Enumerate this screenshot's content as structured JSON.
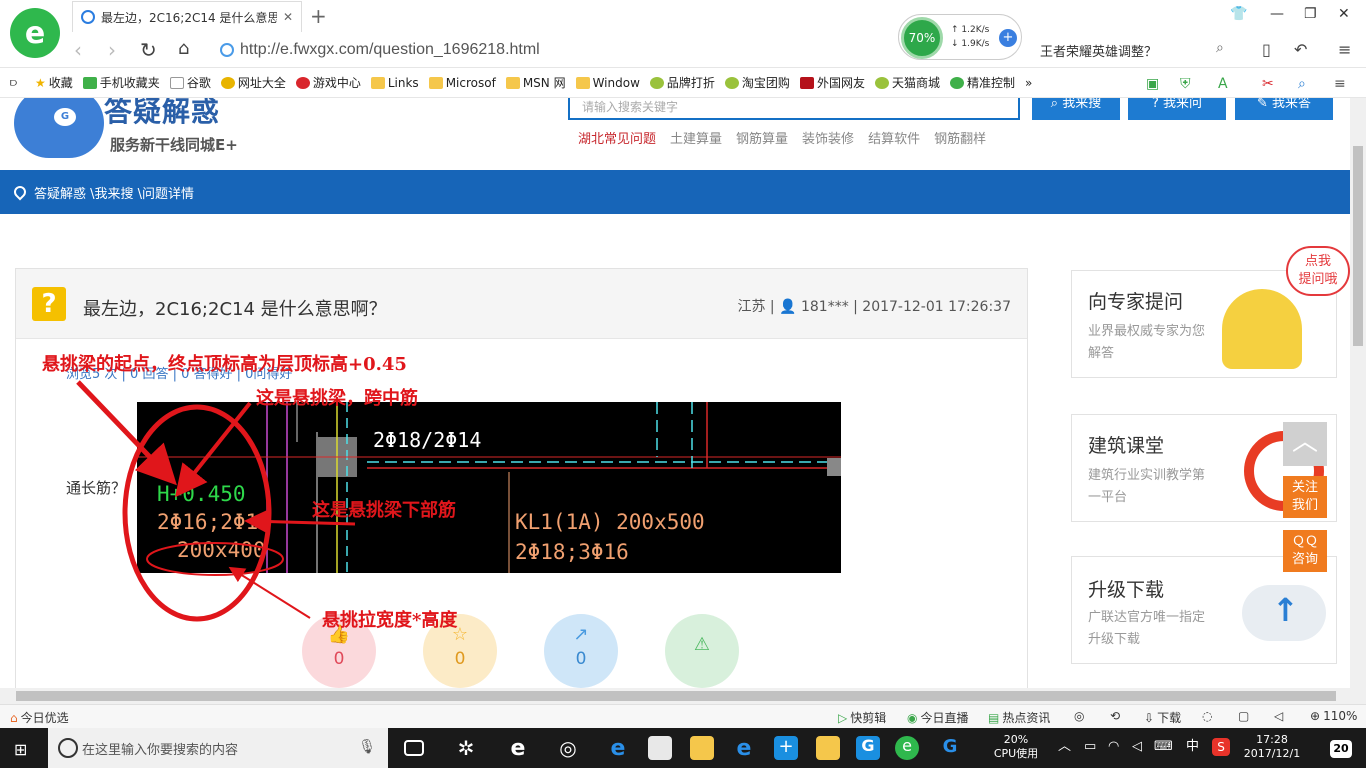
{
  "browser": {
    "tab_title": "最左边，2C16;2C14 是什么意思",
    "url": "http://e.fwxgx.com/question_1696218.html",
    "speed_percent": "70%",
    "speed_up": "1.2K/s",
    "speed_down": "1.9K/s",
    "search_text": "王者荣耀英雄调整？",
    "bookmarks": [
      "收藏",
      "手机收藏夹",
      "谷歌",
      "网址大全",
      "游戏中心",
      "Links",
      "Microsof",
      "MSN 网",
      "Window",
      "品牌打折",
      "淘宝团购",
      "外国网友",
      "天猫商城",
      "精准控制"
    ]
  },
  "site": {
    "name": "答疑解惑",
    "slogan": "服务新干线同城E+",
    "search_placeholder": "请输入搜索关键字",
    "btn_search": "我来搜",
    "btn_ask": "我来问",
    "btn_answer": "我来答",
    "categories": [
      "湖北常见问题",
      "土建算量",
      "钢筋算量",
      "装饰装修",
      "结算软件",
      "钢筋翻样"
    ],
    "breadcrumb": "答疑解惑 \\我来搜 \\问题详情"
  },
  "question": {
    "title": "最左边，2C16;2C14 是什么意思啊？",
    "meta": "江苏 | 👤 181*** | 2017-12-01 17:26:37",
    "stats": "浏览5 次 | 0 回答 | 0 答得好 | 0问得好",
    "body_label": "通长筋？",
    "cad": {
      "beam_label": "2Φ18/2Φ14",
      "elevation": "H+0.450",
      "rebar": "2Φ16;2Φ14",
      "size": "200x400",
      "kl_label": "KL1(1A) 200x500",
      "kl_rebar": "2Φ18;3Φ16"
    },
    "votes": [
      {
        "icon": "👍",
        "count": "0",
        "color": "#fbd9dc"
      },
      {
        "icon": "☆",
        "count": "0",
        "color": "#fcebc7"
      },
      {
        "icon": "↗",
        "count": "0",
        "color": "#cfe6f8"
      },
      {
        "icon": "⚠",
        "count": "",
        "color": "#d8f0dc"
      }
    ]
  },
  "annotations": {
    "a1": "悬挑梁的起点，终点顶标高为层顶标高+0.45",
    "a2": "这是悬挑梁，跨中筋",
    "a3": "这是悬挑梁下部筋",
    "a4": "悬挑拉宽度*高度"
  },
  "sidebar": {
    "bubble": "点我\n提问哦",
    "cards": [
      {
        "title": "向专家提问",
        "desc": "业界最权威专家为您解答"
      },
      {
        "title": "建筑课堂",
        "desc": "建筑行业实训教学第一平台"
      },
      {
        "title": "升级下载",
        "desc": "广联达官方唯一指定升级下载"
      }
    ],
    "follow": "关注\n我们",
    "qq": "ＱＱ\n咨询"
  },
  "statusbar": {
    "left": "今日优选",
    "items": [
      "快剪辑",
      "今日直播",
      "热点资讯",
      "下载",
      "110%"
    ]
  },
  "taskbar": {
    "search_placeholder": "在这里输入你要搜索的内容",
    "cpu": "20%\nCPU使用",
    "ime": "中",
    "time": "17:28",
    "date": "2017/12/1",
    "notif": "20"
  }
}
